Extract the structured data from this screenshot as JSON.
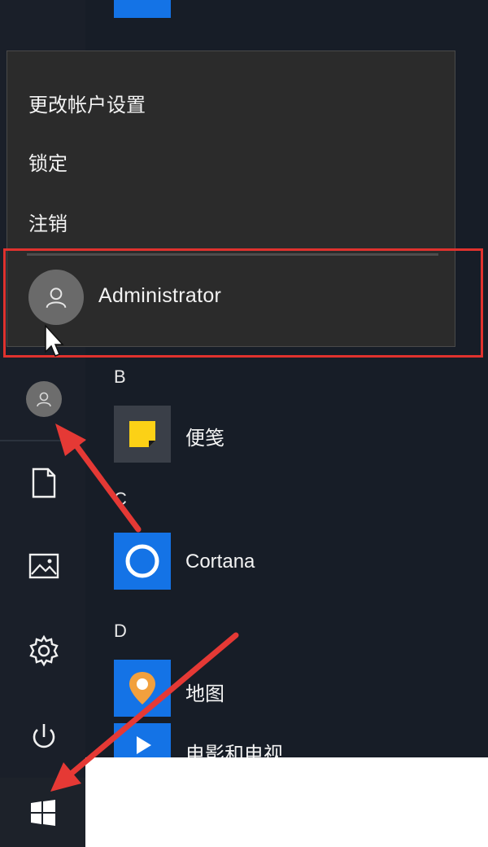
{
  "popup": {
    "items": [
      {
        "label": "更改帐户设置"
      },
      {
        "label": "锁定"
      },
      {
        "label": "注销"
      }
    ],
    "user": "Administrator"
  },
  "apps": {
    "groups": [
      {
        "letter": "B",
        "items": [
          {
            "label": "便笺",
            "icon": "sticky-notes-icon",
            "color": "#fcd116"
          }
        ]
      },
      {
        "letter": "C",
        "items": [
          {
            "label": "Cortana",
            "icon": "cortana-icon",
            "color": "#1473e6"
          }
        ]
      },
      {
        "letter": "D",
        "items": [
          {
            "label": "地图",
            "icon": "maps-icon",
            "color": "#1473e6"
          },
          {
            "label": "电影和电视",
            "icon": "movies-tv-icon",
            "color": "#1473e6"
          }
        ]
      }
    ]
  },
  "rail": {
    "icons": [
      "user-avatar-icon",
      "document-icon",
      "pictures-icon",
      "gear-icon",
      "power-icon"
    ],
    "start": "windows-logo-icon"
  },
  "colors": {
    "background": "#171d27",
    "popup": "#2b2b2b",
    "accent": "#1473e6",
    "highlight": "#e0322e"
  }
}
